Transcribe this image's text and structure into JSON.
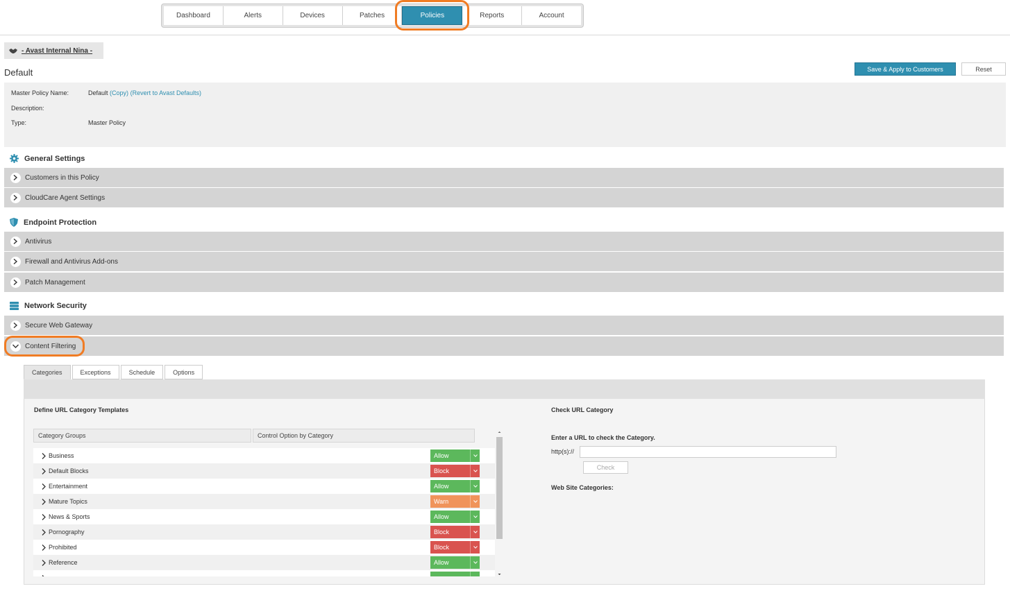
{
  "nav": {
    "tabs": [
      {
        "label": "Dashboard"
      },
      {
        "label": "Alerts"
      },
      {
        "label": "Devices"
      },
      {
        "label": "Patches"
      },
      {
        "label": "Policies"
      },
      {
        "label": "Reports"
      },
      {
        "label": "Account"
      }
    ],
    "active": "Policies"
  },
  "account": {
    "name": "- Avast Internal Nina -"
  },
  "page": {
    "title": "Default",
    "save_label": "Save & Apply to Customers",
    "reset_label": "Reset"
  },
  "policy_info": {
    "name_label": "Master Policy Name:",
    "name_value": "Default",
    "copy_link": "(Copy)",
    "revert_link": "(Revert to Avast Defaults)",
    "description_label": "Description:",
    "type_label": "Type:",
    "type_value": "Master Policy"
  },
  "sections": {
    "general": {
      "title": "General Settings",
      "items": [
        "Customers in this Policy",
        "CloudCare Agent Settings"
      ]
    },
    "endpoint": {
      "title": "Endpoint Protection",
      "items": [
        "Antivirus",
        "Firewall and Antivirus Add-ons",
        "Patch Management"
      ]
    },
    "network": {
      "title": "Network Security",
      "items": [
        "Secure Web Gateway",
        "Content Filtering"
      ]
    }
  },
  "content_filtering": {
    "tabs": [
      "Categories",
      "Exceptions",
      "Schedule",
      "Options"
    ],
    "define_title": "Define URL Category Templates",
    "col_groups": "Category Groups",
    "col_control": "Control Option by Category",
    "categories": [
      {
        "name": "Business",
        "option": "Allow"
      },
      {
        "name": "Default Blocks",
        "option": "Block"
      },
      {
        "name": "Entertainment",
        "option": "Allow"
      },
      {
        "name": "Mature Topics",
        "option": "Warn"
      },
      {
        "name": "News & Sports",
        "option": "Allow"
      },
      {
        "name": "Pornography",
        "option": "Block"
      },
      {
        "name": "Prohibited",
        "option": "Block"
      },
      {
        "name": "Reference",
        "option": "Allow"
      },
      {
        "name": "",
        "option": ""
      }
    ],
    "check_title": "Check URL Category",
    "enter_url_label": "Enter a URL to check the Category.",
    "url_prefix": "http(s)://",
    "url_value": "",
    "check_label": "Check",
    "web_cat_label": "Web Site Categories:"
  },
  "colors": {
    "accent": "#2f8fb0",
    "highlight": "#f07c24",
    "allow": "#5cb85c",
    "block": "#d9534f",
    "warn": "#f0935a"
  }
}
